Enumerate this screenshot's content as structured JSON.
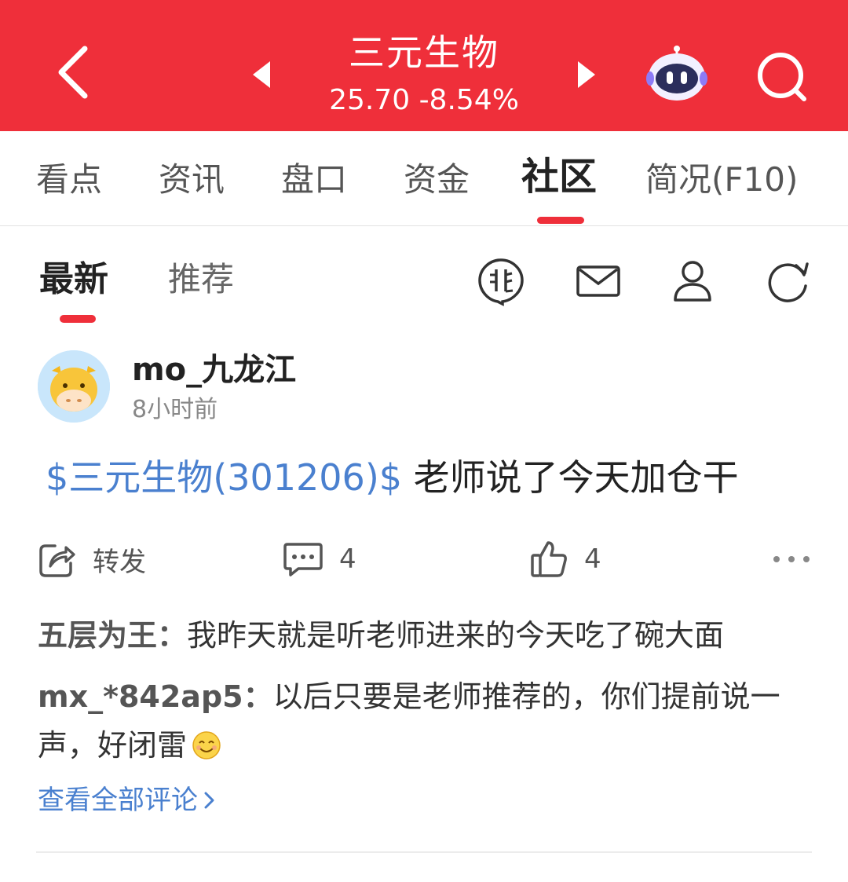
{
  "header": {
    "stock_name": "三元生物",
    "stock_quote": "25.70 -8.54%",
    "bg_color": "#ef2f3a"
  },
  "tabs": [
    {
      "label": "看点"
    },
    {
      "label": "资讯"
    },
    {
      "label": "盘口"
    },
    {
      "label": "资金"
    },
    {
      "label": "社区",
      "active": true
    },
    {
      "label": "简况(F10)"
    }
  ],
  "subtabs": [
    {
      "label": "最新",
      "active": true
    },
    {
      "label": "推荐"
    }
  ],
  "post": {
    "username": "mo_九龙江",
    "time": "8小时前",
    "stock_tag": "$三元生物(301206)$",
    "text": " 老师说了今天加仓干",
    "actions": {
      "forward_label": "转发",
      "comment_count": "4",
      "like_count": "4"
    },
    "comments": [
      {
        "user": "五层为王：",
        "text": "我昨天就是听老师进来的今天吃了碗大面"
      },
      {
        "user": "mx_*842ap5：",
        "text": "以后只要是老师推荐的，你们提前说一声，好闭雷"
      }
    ],
    "view_all_label": "查看全部评论"
  },
  "colors": {
    "accent_red": "#ef2f3a",
    "link_blue": "#4a80cf"
  },
  "icons": [
    "back-arrow-icon",
    "prev-triangle-icon",
    "next-triangle-icon",
    "robot-assistant-icon",
    "search-icon",
    "bull-topic-icon",
    "mail-icon",
    "user-icon",
    "refresh-icon",
    "forward-icon",
    "comment-icon",
    "like-icon",
    "more-icon",
    "chevron-right-icon",
    "smile-emoji-icon"
  ]
}
